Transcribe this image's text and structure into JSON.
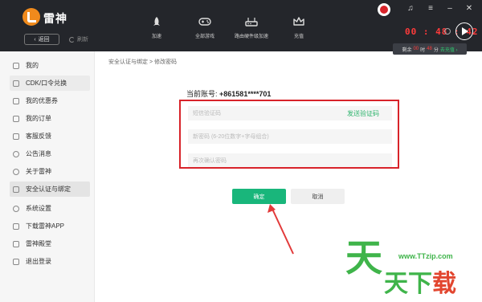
{
  "app": {
    "brand": "雷神",
    "back_label": "返回",
    "refresh_label": "刷新",
    "accent": "#f08a1c"
  },
  "nav": [
    {
      "label": "加速",
      "icon": "rocket-icon"
    },
    {
      "label": "全部游戏",
      "icon": "gamepad-icon"
    },
    {
      "label": "路由硬件级加速",
      "icon": "router-icon"
    },
    {
      "label": "充值",
      "icon": "crown-icon"
    }
  ],
  "status": {
    "timer": "00 : 48 : 42",
    "remain_prefix": "剩余",
    "remain_time_h": "00",
    "remain_time_h_unit": "时",
    "remain_time_m": "48",
    "remain_time_m_unit": "分",
    "recharge": "去充值 ›"
  },
  "sidebar": {
    "items": [
      {
        "label": "我的",
        "icon": "user-icon"
      },
      {
        "label": "CDK/口令兑换",
        "icon": "cdk-icon"
      },
      {
        "label": "我的优惠券",
        "icon": "coupon-icon"
      },
      {
        "label": "我的订单",
        "icon": "order-icon"
      },
      {
        "label": "客服反馈",
        "icon": "feedback-icon"
      },
      {
        "label": "公告消息",
        "icon": "notice-icon"
      },
      {
        "label": "关于雷神",
        "icon": "info-icon"
      },
      {
        "label": "安全认证与绑定",
        "icon": "shield-icon"
      },
      {
        "label": "系统设置",
        "icon": "gear-icon"
      },
      {
        "label": "下载雷神APP",
        "icon": "phone-icon"
      },
      {
        "label": "雷神殿堂",
        "icon": "hall-icon"
      },
      {
        "label": "退出登录",
        "icon": "logout-icon"
      }
    ],
    "active_index": 7
  },
  "main": {
    "breadcrumb": "安全认证与绑定 > 修改密码",
    "account_label": "当前账号:",
    "account_value": "+861581****701",
    "sms_placeholder": "短信验证码",
    "send_code": "发送验证码",
    "new_pwd_placeholder": "新密码 (6-20位数字+字母组合)",
    "confirm_pwd_placeholder": "再次确认密码",
    "ok_label": "确定",
    "cancel_label": "取消"
  },
  "watermark": {
    "site": "www.TTzip.com",
    "big_char": "天",
    "row_chars": "天下载"
  }
}
